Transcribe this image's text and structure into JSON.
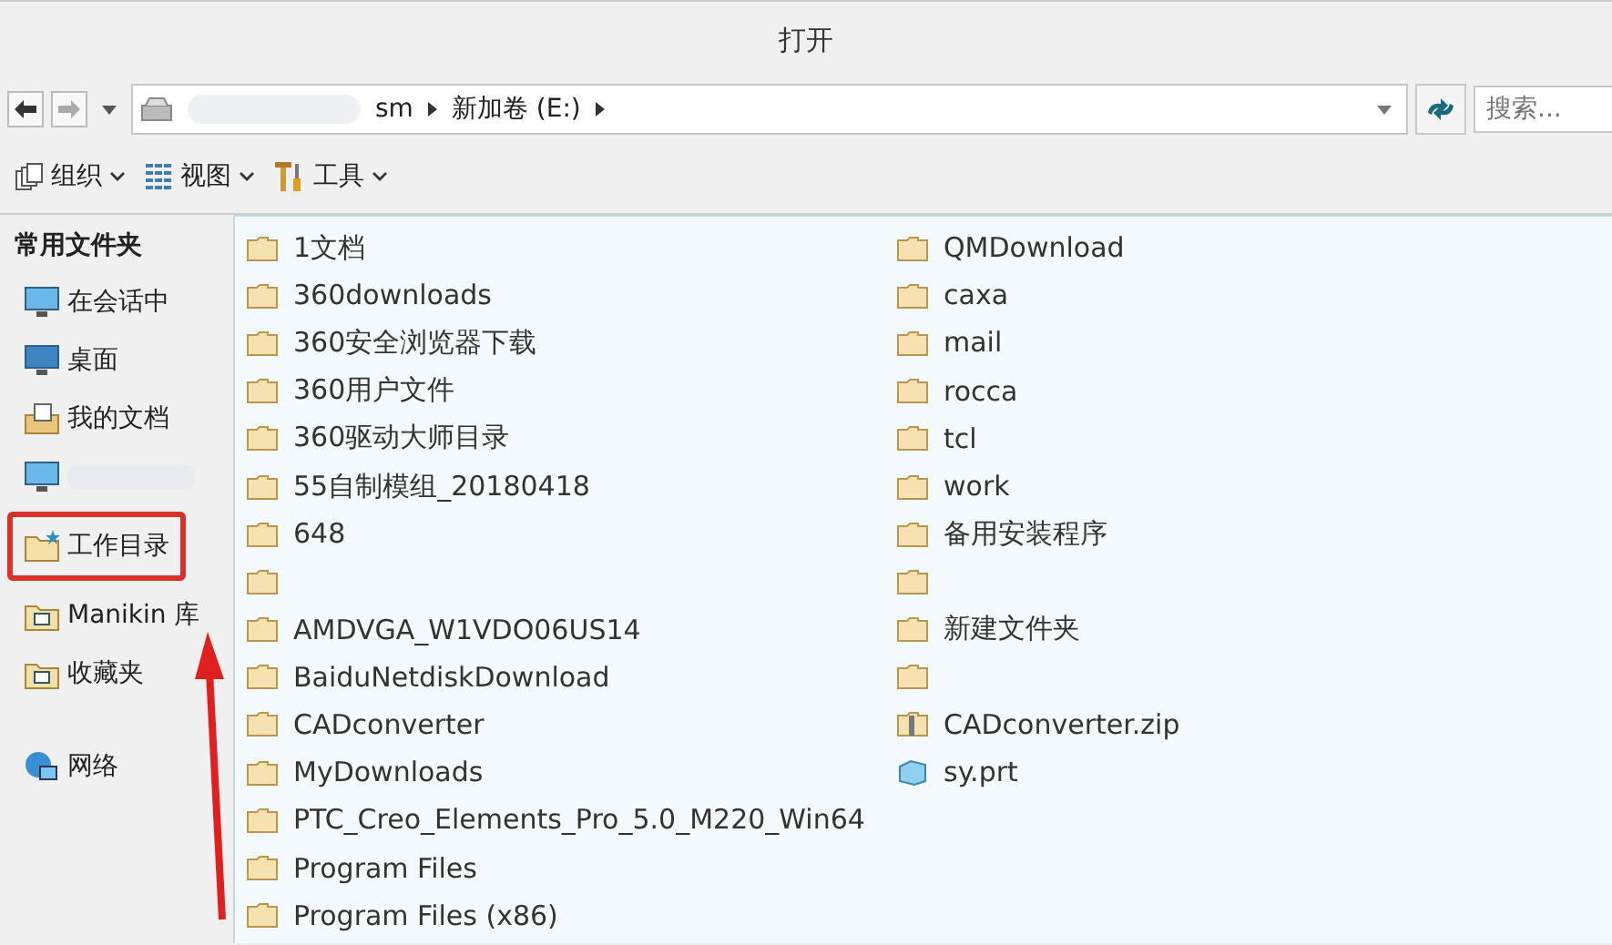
{
  "window": {
    "title": "打开"
  },
  "address_bar": {
    "crumbs": [
      "sm",
      "新加卷 (E:)"
    ]
  },
  "search": {
    "placeholder": "搜索..."
  },
  "toolbar": [
    {
      "label": "组织"
    },
    {
      "label": "视图"
    },
    {
      "label": "工具"
    }
  ],
  "sidebar": {
    "heading": "常用文件夹",
    "items": [
      {
        "label": "在会话中",
        "kind": "monitor",
        "highlighted": false
      },
      {
        "label": "桌面",
        "kind": "desktop",
        "highlighted": false
      },
      {
        "label": "我的文档",
        "kind": "docs",
        "highlighted": false
      },
      {
        "kind": "monitor",
        "highlighted": false
      },
      {
        "label": "工作目录",
        "kind": "workdir",
        "highlighted": true
      },
      {
        "label": "Manikin 库",
        "kind": "library",
        "highlighted": false
      },
      {
        "label": "收藏夹",
        "kind": "favorites",
        "highlighted": false
      },
      {
        "label": "网络",
        "kind": "network",
        "highlighted": false
      }
    ]
  },
  "files": {
    "column_1": [
      {
        "name": "1文档",
        "kind": "folder"
      },
      {
        "name": "360downloads",
        "kind": "folder"
      },
      {
        "name": "360安全浏览器下载",
        "kind": "folder"
      },
      {
        "name": "360用户文件",
        "kind": "folder"
      },
      {
        "name": "360驱动大师目录",
        "kind": "folder"
      },
      {
        "name": "55自制模组_20180418",
        "kind": "folder"
      },
      {
        "name": "648",
        "kind": "folder"
      },
      {
        "kind": "folder"
      },
      {
        "name": "AMDVGA_W1VDO06US14",
        "kind": "folder"
      },
      {
        "name": "BaiduNetdiskDownload",
        "kind": "folder"
      },
      {
        "name": "CADconverter",
        "kind": "folder"
      },
      {
        "name": "MyDownloads",
        "kind": "folder"
      },
      {
        "name": "PTC_Creo_Elements_Pro_5.0_M220_Win64",
        "kind": "folder"
      },
      {
        "name": "Program Files",
        "kind": "folder"
      },
      {
        "name": "Program Files (x86)",
        "kind": "folder"
      }
    ],
    "column_2": [
      {
        "name": "QMDownload",
        "kind": "folder"
      },
      {
        "name": "caxa",
        "kind": "folder"
      },
      {
        "name": "mail",
        "kind": "folder"
      },
      {
        "name": "rocca",
        "kind": "folder"
      },
      {
        "name": "tcl",
        "kind": "folder"
      },
      {
        "name": "work",
        "kind": "folder"
      },
      {
        "name": "备用安装程序",
        "kind": "folder"
      },
      {
        "kind": "folder"
      },
      {
        "name": "新建文件夹",
        "kind": "folder"
      },
      {
        "kind": "folder"
      },
      {
        "name": "CADconverter.zip",
        "kind": "zip"
      },
      {
        "name": "sy.prt",
        "kind": "part"
      }
    ]
  }
}
